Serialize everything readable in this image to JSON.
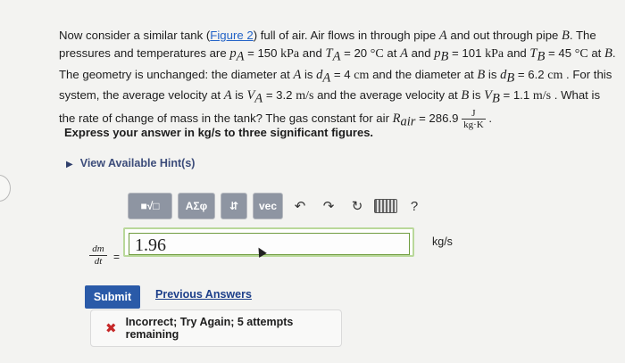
{
  "problem": {
    "intro": "Now consider a similar tank (",
    "figure_link": "Figure 2",
    "p1": ") full of air. Air flows in through pipe ",
    "A1": "A",
    "p2": " and out through pipe ",
    "B1": "B",
    "p3": ". The pressures and temperatures are ",
    "pA": "p",
    "pA_sub": "A",
    "pA_val": " = 150 ",
    "pA_unit": "kPa",
    "and1": " and ",
    "TA": "T",
    "TA_sub": "A",
    "TA_val": " = 20 ",
    "TA_unit": "°C",
    "at_A": " at ",
    "A2": "A",
    "and2": " and ",
    "pB": "p",
    "pB_sub": "B",
    "pB_val": " = 101 ",
    "pB_unit": "kPa",
    "and3": " and ",
    "TB": "T",
    "TB_sub": "B",
    "TB_val": " = 45 ",
    "TB_unit": "°C",
    "at_B": " at ",
    "B2": "B",
    "p4": ". The geometry is unchanged: the diameter at ",
    "A3": "A",
    "is1": " is ",
    "dA": "d",
    "dA_sub": "A",
    "dA_val": " = 4 ",
    "dA_unit": "cm",
    "p5": " and the diameter at ",
    "B3": "B",
    "is2": " is ",
    "dB": "d",
    "dB_sub": "B",
    "dB_val": " = 6.2 ",
    "dB_unit": "cm",
    "p6": " . For this system, the average velocity at ",
    "A4": "A",
    "is3": " is ",
    "VA": "V",
    "VA_sub": "A",
    "VA_val": " = 3.2 ",
    "VA_unit": "m/s",
    "p7": " and the average velocity at ",
    "B4": "B",
    "is4": " is ",
    "VB": "V",
    "VB_sub": "B",
    "VB_val": " = 1.1 ",
    "VB_unit": "m/s",
    "p8": " . What is the rate of change of mass in the tank? The gas constant for air ",
    "R": "R",
    "R_sub": "air",
    "R_val": " = 286.9 ",
    "R_num": "J",
    "R_den": "kg·K",
    "end": " ."
  },
  "instruction": "Express your answer in kg/s to three significant figures.",
  "hint": {
    "caret": "▶",
    "label": "View Available Hint(s)"
  },
  "toolbar": {
    "templates_label": "■√□",
    "greek_label": "ΑΣφ",
    "arrows_label": "⇵",
    "vec_label": "vec",
    "undo_icon": "↶",
    "redo_icon": "↷",
    "reset_icon": "↻",
    "help_label": "?"
  },
  "answer": {
    "lhs_num": "dm",
    "lhs_den": "dt",
    "eq": "=",
    "value": "1.96",
    "units": "kg/s"
  },
  "actions": {
    "submit_label": "Submit",
    "previous_label": "Previous Answers"
  },
  "feedback": {
    "icon": "✖",
    "text": "Incorrect; Try Again; 5 attempts remaining"
  },
  "colors": {
    "submit_bg": "#2a5aa8",
    "link": "#2363c7",
    "error": "#c62828",
    "answer_border": "#6f9c3f",
    "toolbar_btn": "#8e95a2"
  }
}
